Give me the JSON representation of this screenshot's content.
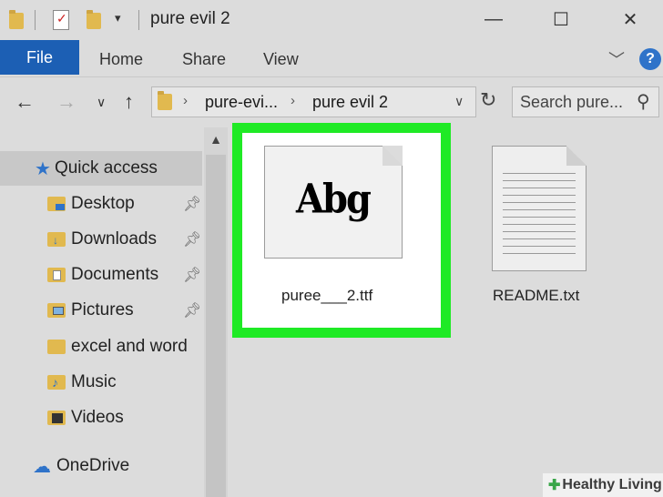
{
  "window": {
    "title": "pure evil 2",
    "minimize": "—",
    "maximize": "☐",
    "close": "✕"
  },
  "ribbon": {
    "tabs": [
      "File",
      "Home",
      "Share",
      "View"
    ],
    "help": "?"
  },
  "address": {
    "crumbs": [
      "pure-evi...",
      "pure evil 2"
    ],
    "search_placeholder": "Search pure..."
  },
  "nav": {
    "quick_access": "Quick access",
    "items": [
      {
        "label": "Desktop",
        "pinned": true
      },
      {
        "label": "Downloads",
        "pinned": true
      },
      {
        "label": "Documents",
        "pinned": true
      },
      {
        "label": "Pictures",
        "pinned": true
      },
      {
        "label": "excel and word",
        "pinned": false
      },
      {
        "label": "Music",
        "pinned": false
      },
      {
        "label": "Videos",
        "pinned": false
      }
    ],
    "onedrive": "OneDrive"
  },
  "files": [
    {
      "name": "puree___2.ttf",
      "preview": "Abg",
      "selected": true
    },
    {
      "name": "README.txt",
      "selected": false
    }
  ],
  "watermark": "Healthy Living",
  "colors": {
    "accent": "#1c5fb4",
    "selection_highlight": "#1fea25",
    "folder": "#e1b94f"
  }
}
